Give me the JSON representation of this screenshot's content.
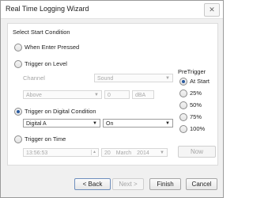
{
  "window": {
    "title": "Real Time Logging Wizard",
    "close_glyph": "✕"
  },
  "heading": "Select Start Condition",
  "options": {
    "enter": "When Enter Pressed",
    "level": "Trigger on Level",
    "digital": "Trigger on Digital Condition",
    "time": "Trigger on Time",
    "selected": "digital"
  },
  "level": {
    "channel_label": "Channel",
    "channel_value": "Sound",
    "direction_value": "Above",
    "threshold_value": "0",
    "unit_value": "dBA"
  },
  "digital": {
    "input_value": "Digital A",
    "state_value": "On"
  },
  "time": {
    "time_value": "13:56:53",
    "day": "20",
    "month": "March",
    "year": "2014",
    "now_label": "Now"
  },
  "pretrigger": {
    "title": "PreTrigger",
    "options": [
      "At Start",
      "25%",
      "50%",
      "75%",
      "100%"
    ],
    "selected": "At Start"
  },
  "buttons": {
    "back": "< Back",
    "next": "Next >",
    "finish": "Finish",
    "cancel": "Cancel"
  },
  "icons": {
    "dropdown": "chevron-down-icon",
    "spinner": "spinner-arrows-icon",
    "close": "close-icon"
  }
}
